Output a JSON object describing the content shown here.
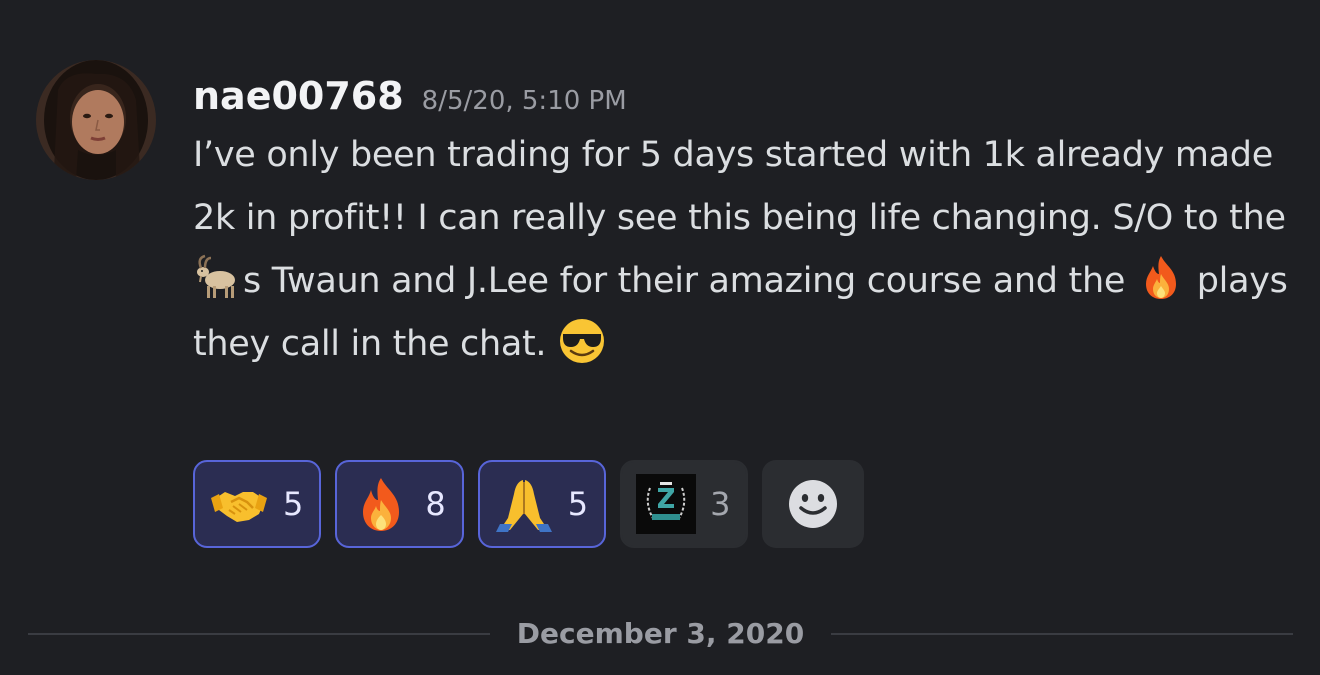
{
  "message": {
    "author": "nae00768",
    "timestamp": "8/5/20, 5:10 PM",
    "avatar_icon": "profile-photo",
    "text_part1": "I’ve only been trading for 5 days started with 1k already made 2k in profit!! I can really see this being life changing. S/O to the ",
    "inline_emoji_1": "goat",
    "text_part2": "s Twaun and J.Lee for their amazing course and the ",
    "inline_emoji_2": "fire",
    "text_part3": " plays they call in the chat. ",
    "inline_emoji_3": "smiling-face-with-sunglasses"
  },
  "reactions": [
    {
      "emoji": "handshake",
      "count": "5",
      "active": true
    },
    {
      "emoji": "fire",
      "count": "8",
      "active": true
    },
    {
      "emoji": "folded-hands",
      "count": "5",
      "active": true
    },
    {
      "emoji": "custom-server-logo",
      "count": "3",
      "active": false
    }
  ],
  "add_reaction_icon": "smiley-add-icon",
  "date_divider": "December 3, 2020",
  "colors": {
    "background": "#1e1f23",
    "active_reaction_bg": "#2b2d52",
    "active_reaction_border": "#5865d9",
    "inactive_reaction_bg": "#2b2d31"
  }
}
